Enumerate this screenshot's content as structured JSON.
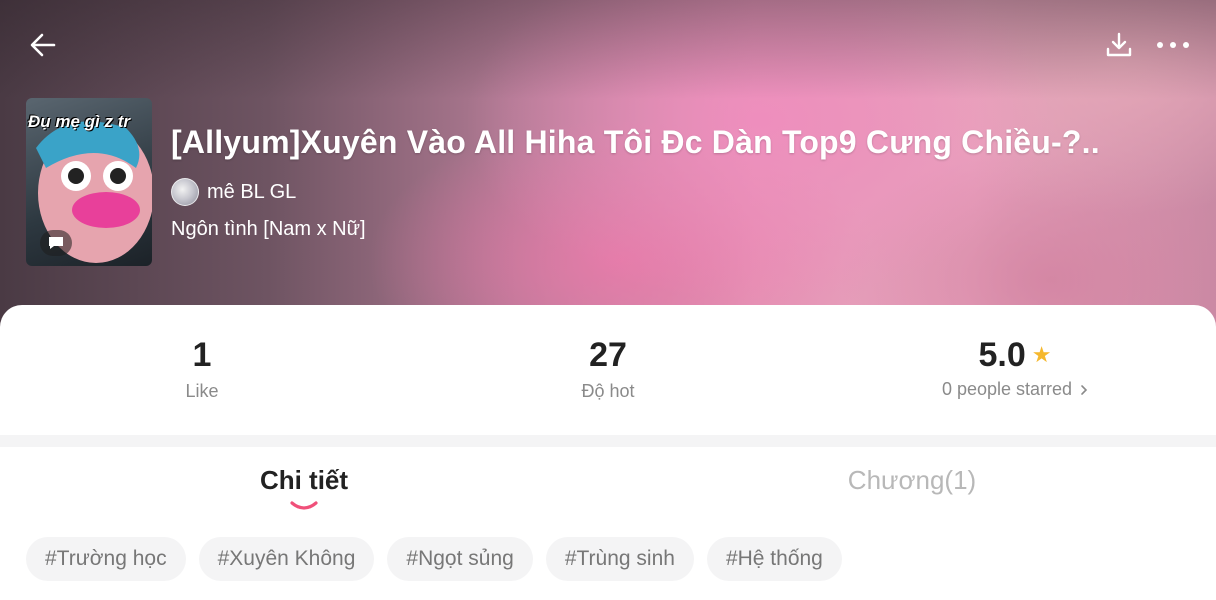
{
  "header": {
    "back_icon": "arrow-left-icon",
    "download_icon": "download-icon",
    "more_icon": "more-dots-icon"
  },
  "book": {
    "cover_text": "Đụ mẹ gì z tr",
    "title": "[Allyum]Xuyên Vào All Hiha Tôi Đc Dàn Top9 Cưng Chiều-?..",
    "author": "mê BL GL",
    "genre": "Ngôn tình [Nam x Nữ]"
  },
  "stats": {
    "like_value": "1",
    "like_label": "Like",
    "hot_value": "27",
    "hot_label": "Độ hot",
    "rating_value": "5.0",
    "starred_label": "0 people starred",
    "star_color": "#f5b82e"
  },
  "tabs": {
    "detail": "Chi tiết",
    "chapters": "Chương(1)",
    "indicator_color": "#f0507a"
  },
  "tags": [
    "#Trường học",
    "#Xuyên Không",
    "#Ngọt sủng",
    "#Trùng sinh",
    "#Hệ thống"
  ]
}
